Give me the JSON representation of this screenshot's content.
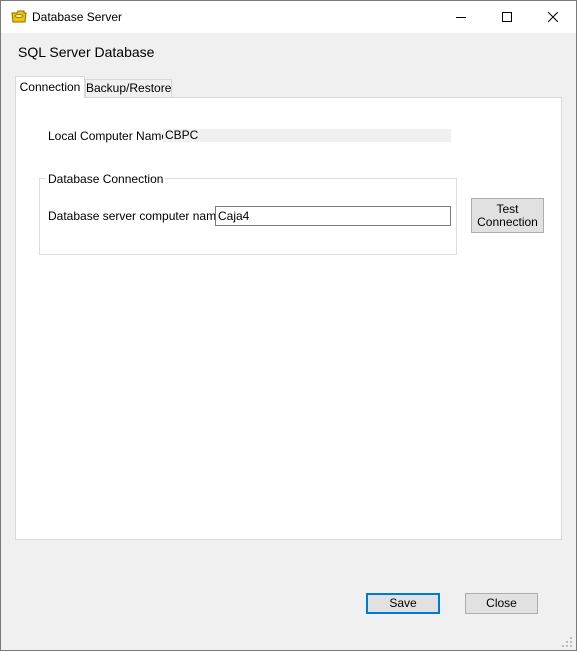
{
  "window": {
    "title": "Database Server",
    "icon": "database-folder-icon",
    "controls": [
      "minimize-icon",
      "maximize-icon",
      "close-icon"
    ]
  },
  "heading": "SQL Server Database",
  "tabs": [
    {
      "label": "Connection",
      "active": true
    },
    {
      "label": "Backup/Restore",
      "active": false
    }
  ],
  "connection": {
    "local_label": "Local Computer Name:",
    "local_value": "CBPC",
    "group_title": "Database Connection",
    "server_label": "Database server computer name:",
    "server_value": "Caja4",
    "test_button_line1": "Test",
    "test_button_line2": "Connection"
  },
  "footer": {
    "save_label": "Save",
    "close_label": "Close"
  },
  "colors": {
    "accent": "#0078d7",
    "window_bg": "#f0f0f0",
    "icon_yellow": "#f5c400"
  }
}
